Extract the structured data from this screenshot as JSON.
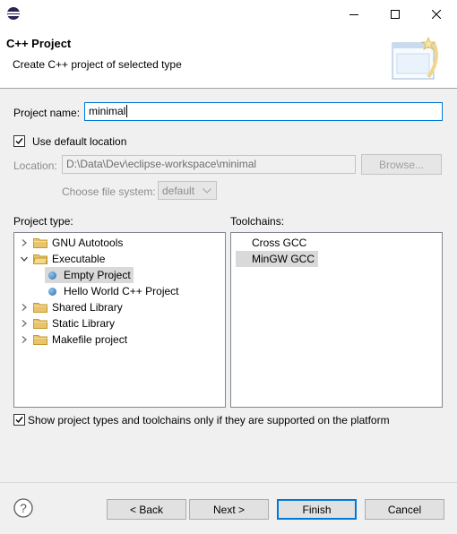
{
  "window": {
    "app_icon": "eclipse-icon",
    "controls": [
      "minimize-icon",
      "maximize-icon",
      "close-icon"
    ]
  },
  "banner": {
    "title": "C++ Project",
    "description": "Create C++ project of selected type",
    "image": "wizard-banner-icon"
  },
  "form": {
    "project_name_label": "Project name:",
    "project_name_value": "minimal",
    "use_default_location_label": "Use default location",
    "use_default_location_checked": true,
    "location_label": "Location:",
    "location_value": "D:\\Data\\Dev\\eclipse-workspace\\minimal",
    "browse_label": "Browse...",
    "choose_fs_label": "Choose file system:",
    "fs_value": "default"
  },
  "project_type": {
    "label": "Project type:",
    "items": [
      {
        "label": "GNU Autotools",
        "icon": "folder-icon",
        "expanded": false
      },
      {
        "label": "Executable",
        "icon": "folder-icon",
        "expanded": true
      },
      {
        "label": "Empty Project",
        "icon": "project-type-icon",
        "selected": true
      },
      {
        "label": "Hello World C++ Project",
        "icon": "project-type-icon"
      },
      {
        "label": "Shared Library",
        "icon": "folder-icon",
        "expanded": false
      },
      {
        "label": "Static Library",
        "icon": "folder-icon",
        "expanded": false
      },
      {
        "label": "Makefile project",
        "icon": "folder-icon",
        "expanded": false
      }
    ]
  },
  "toolchains": {
    "label": "Toolchains:",
    "items": [
      {
        "label": "Cross GCC"
      },
      {
        "label": "MinGW GCC",
        "selected": true
      }
    ]
  },
  "filter": {
    "label": "Show project types and toolchains only if they are supported on the platform",
    "checked": true
  },
  "buttons": {
    "help_icon": "help-icon",
    "back": "< Back",
    "next": "Next >",
    "finish": "Finish",
    "cancel": "Cancel"
  },
  "colors": {
    "accent": "#0078d7",
    "folder": "#e8c46a",
    "selection": "#d9d9d9"
  }
}
